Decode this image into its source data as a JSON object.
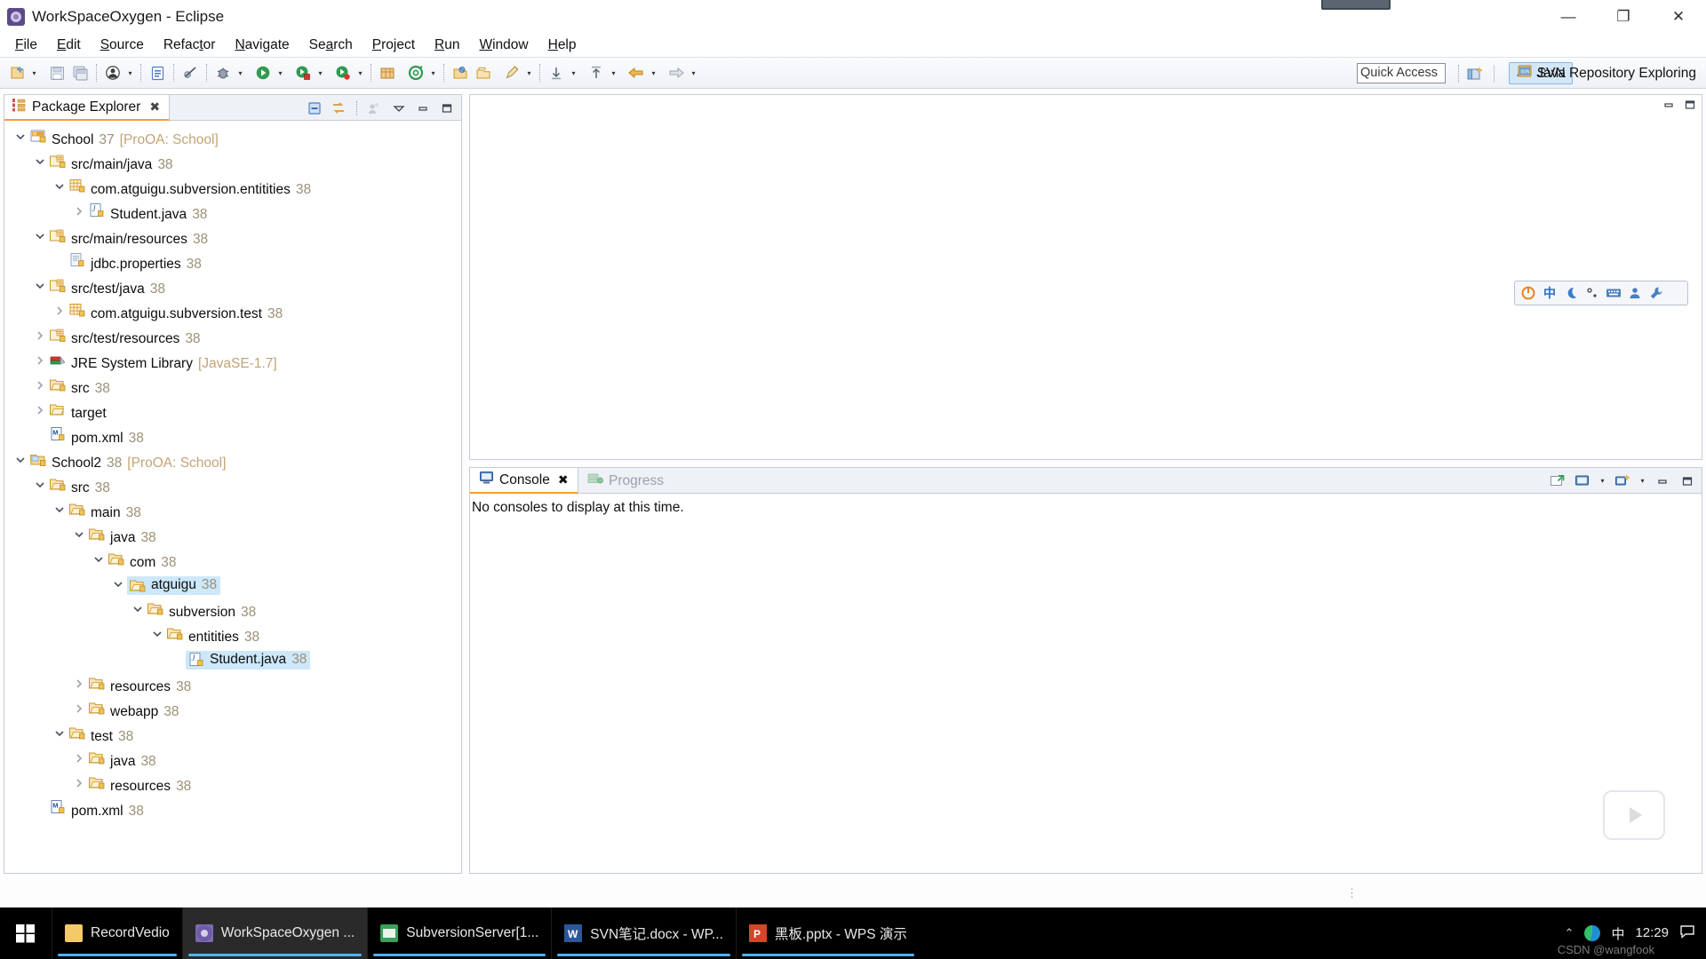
{
  "window": {
    "title": "WorkSpaceOxygen - Eclipse",
    "app_icon": "eclipse-icon",
    "minimize": "—",
    "maximize": "❐",
    "close": "✕"
  },
  "menubar": {
    "items": [
      {
        "label": "File",
        "mnemonic": "F"
      },
      {
        "label": "Edit",
        "mnemonic": "E"
      },
      {
        "label": "Source",
        "mnemonic": "S"
      },
      {
        "label": "Refactor",
        "mnemonic": "t"
      },
      {
        "label": "Navigate",
        "mnemonic": "N"
      },
      {
        "label": "Search",
        "mnemonic": "a"
      },
      {
        "label": "Project",
        "mnemonic": "P"
      },
      {
        "label": "Run",
        "mnemonic": "R"
      },
      {
        "label": "Window",
        "mnemonic": "W"
      },
      {
        "label": "Help",
        "mnemonic": "H"
      }
    ]
  },
  "toolbar": {
    "quick_access_placeholder": "Quick Access",
    "quick_access_value": "",
    "buttons": [
      {
        "name": "new-wizard-icon",
        "color": "#f0c041"
      },
      {
        "name": "save-icon",
        "color": "#b9c2d0"
      },
      {
        "name": "save-all-icon",
        "color": "#a9b4c4"
      },
      {
        "name": "print-icon",
        "color": "#4a4a4a"
      },
      {
        "name": "toggle-mark-occurrences-icon",
        "color": "#4f7ec4"
      },
      {
        "name": "skip-breakpoints-icon",
        "color": "#556070"
      },
      {
        "name": "debug-icon",
        "color": "#6f6f6f"
      },
      {
        "name": "run-icon",
        "color": "#2e9b4e"
      },
      {
        "name": "coverage-icon",
        "color": "#2e9b4e"
      },
      {
        "name": "run-external-tools-icon",
        "color": "#2e9b4e"
      },
      {
        "name": "new-java-project-icon",
        "color": "#d79a3e"
      },
      {
        "name": "new-annotation-icon",
        "color": "#2e9b4e"
      },
      {
        "name": "open-type-icon",
        "color": "#d79a3e"
      },
      {
        "name": "open-task-icon",
        "color": "#e3a84b"
      },
      {
        "name": "search-icon",
        "color": "#c2a25e"
      },
      {
        "name": "previous-annotation-icon",
        "color": "#6e7685"
      },
      {
        "name": "next-annotation-icon",
        "color": "#6e7685"
      },
      {
        "name": "back-icon",
        "color": "#d6a23f"
      },
      {
        "name": "forward-icon",
        "color": "#b6bdc8"
      }
    ],
    "open-perspective-icon": "open-perspective-icon",
    "perspectives": [
      {
        "label": "Java",
        "icon": "java-perspective-icon",
        "active": true
      },
      {
        "label": "SVN Repository Exploring",
        "icon": "svn-perspective-icon",
        "active": false
      }
    ]
  },
  "explorer": {
    "tab_label": "Package Explorer",
    "tab_close": "✖",
    "actions": [
      {
        "name": "collapse-all-icon"
      },
      {
        "name": "link-with-editor-icon"
      },
      {
        "name": "focus-on-active-task-icon"
      },
      {
        "name": "view-menu-icon"
      },
      {
        "name": "minimize-view-icon"
      },
      {
        "name": "maximize-view-icon"
      }
    ],
    "tree": [
      {
        "indent": 0,
        "twist": "down",
        "icon": "maven-project-icon",
        "label": "School",
        "num": "37",
        "loc": "[ProOA: School]",
        "selected": false
      },
      {
        "indent": 1,
        "twist": "down",
        "icon": "source-folder-icon",
        "label": "src/main/java",
        "num": "38",
        "loc": "",
        "selected": false
      },
      {
        "indent": 2,
        "twist": "down",
        "icon": "package-icon",
        "label": "com.atguigu.subversion.entitities",
        "num": "38",
        "loc": "",
        "selected": false
      },
      {
        "indent": 3,
        "twist": "right",
        "icon": "java-file-icon",
        "label": "Student.java",
        "num": "38",
        "loc": "",
        "selected": false
      },
      {
        "indent": 1,
        "twist": "down",
        "icon": "source-folder-icon",
        "label": "src/main/resources",
        "num": "38",
        "loc": "",
        "selected": false
      },
      {
        "indent": 2,
        "twist": "none",
        "icon": "properties-file-icon",
        "label": "jdbc.properties",
        "num": "38",
        "loc": "",
        "selected": false
      },
      {
        "indent": 1,
        "twist": "down",
        "icon": "source-folder-icon",
        "label": "src/test/java",
        "num": "38",
        "loc": "",
        "selected": false
      },
      {
        "indent": 2,
        "twist": "right",
        "icon": "package-icon",
        "label": "com.atguigu.subversion.test",
        "num": "38",
        "loc": "",
        "selected": false
      },
      {
        "indent": 1,
        "twist": "right",
        "icon": "source-folder-icon",
        "label": "src/test/resources",
        "num": "38",
        "loc": "",
        "selected": false
      },
      {
        "indent": 1,
        "twist": "right",
        "icon": "jre-library-icon",
        "label": "JRE System Library",
        "num": "",
        "loc": "[JavaSE-1.7]",
        "selected": false
      },
      {
        "indent": 1,
        "twist": "right",
        "icon": "folder-icon",
        "label": "src",
        "num": "38",
        "loc": "",
        "selected": false
      },
      {
        "indent": 1,
        "twist": "right",
        "icon": "folder-plain-icon",
        "label": "target",
        "num": "",
        "loc": "",
        "selected": false
      },
      {
        "indent": 1,
        "twist": "none",
        "icon": "xml-file-icon",
        "label": "pom.xml",
        "num": "38",
        "loc": "",
        "selected": false
      },
      {
        "indent": 0,
        "twist": "down",
        "icon": "project-icon",
        "label": "School2",
        "num": "38",
        "loc": "[ProOA: School]",
        "selected": false
      },
      {
        "indent": 1,
        "twist": "down",
        "icon": "folder-icon",
        "label": "src",
        "num": "38",
        "loc": "",
        "selected": false
      },
      {
        "indent": 2,
        "twist": "down",
        "icon": "folder-icon",
        "label": "main",
        "num": "38",
        "loc": "",
        "selected": false
      },
      {
        "indent": 3,
        "twist": "down",
        "icon": "folder-icon",
        "label": "java",
        "num": "38",
        "loc": "",
        "selected": false
      },
      {
        "indent": 4,
        "twist": "down",
        "icon": "folder-icon",
        "label": "com",
        "num": "38",
        "loc": "",
        "selected": false
      },
      {
        "indent": 5,
        "twist": "down",
        "icon": "folder-icon",
        "label": "atguigu",
        "num": "38",
        "loc": "",
        "selected": true
      },
      {
        "indent": 6,
        "twist": "down",
        "icon": "folder-icon",
        "label": "subversion",
        "num": "38",
        "loc": "",
        "selected": false
      },
      {
        "indent": 7,
        "twist": "down",
        "icon": "folder-icon",
        "label": "entitities",
        "num": "38",
        "loc": "",
        "selected": false
      },
      {
        "indent": 8,
        "twist": "none",
        "icon": "java-file-icon",
        "label": "Student.java",
        "num": "38",
        "loc": "",
        "selected": true
      },
      {
        "indent": 3,
        "twist": "right",
        "icon": "folder-icon",
        "label": "resources",
        "num": "38",
        "loc": "",
        "selected": false
      },
      {
        "indent": 3,
        "twist": "right",
        "icon": "folder-icon",
        "label": "webapp",
        "num": "38",
        "loc": "",
        "selected": false
      },
      {
        "indent": 2,
        "twist": "down",
        "icon": "folder-icon",
        "label": "test",
        "num": "38",
        "loc": "",
        "selected": false
      },
      {
        "indent": 3,
        "twist": "right",
        "icon": "folder-icon",
        "label": "java",
        "num": "38",
        "loc": "",
        "selected": false
      },
      {
        "indent": 3,
        "twist": "right",
        "icon": "folder-icon",
        "label": "resources",
        "num": "38",
        "loc": "",
        "selected": false
      },
      {
        "indent": 1,
        "twist": "none",
        "icon": "xml-file-icon",
        "label": "pom.xml",
        "num": "38",
        "loc": "",
        "selected": false
      }
    ]
  },
  "editor": {
    "minimize": "—",
    "maximize": "❐"
  },
  "ime_bar": {
    "items": [
      "power-icon",
      "chinese-mode-icon",
      "moon-icon",
      "punctuation-icon",
      "keyboard-icon",
      "user-icon",
      "wrench-icon"
    ],
    "chinese_label": "中",
    "accent": "#e8821e"
  },
  "console": {
    "tabs": [
      {
        "label": "Console",
        "icon": "console-icon",
        "active": true,
        "close": "✖"
      },
      {
        "label": "Progress",
        "icon": "progress-icon",
        "active": false,
        "close": ""
      }
    ],
    "message": "No consoles to display at this time.",
    "actions": [
      {
        "name": "open-console-icon"
      },
      {
        "name": "display-selected-console-icon"
      },
      {
        "name": "display-selected-console-dropdown-icon"
      },
      {
        "name": "new-console-view-icon"
      },
      {
        "name": "new-console-view-dropdown-icon"
      },
      {
        "name": "minimize-console-icon"
      },
      {
        "name": "maximize-console-icon"
      }
    ]
  },
  "wps_widget": {
    "icon": "play-icon"
  },
  "taskbar": {
    "start": "start-icon",
    "items": [
      {
        "label": "RecordVedio",
        "icon": "recordvedio-icon",
        "color": "#f3c969",
        "active": false
      },
      {
        "label": "WorkSpaceOxygen ...",
        "icon": "eclipse-icon",
        "color": "#7b6bb0",
        "active": true
      },
      {
        "label": "SubversionServer[1...",
        "icon": "subversion-icon",
        "color": "#3aa05a",
        "active": false
      },
      {
        "label": "SVN笔记.docx - WP...",
        "icon": "word-icon",
        "color": "#2b579a",
        "active": false
      },
      {
        "label": "黑板.pptx - WPS 演示",
        "icon": "powerpoint-icon",
        "color": "#d24726",
        "active": false
      }
    ],
    "tray": {
      "chevron": "⌃",
      "ime_label": "中",
      "clock_time": "12:29",
      "clock_date": ""
    },
    "watermark": "CSDN @wangfook"
  }
}
